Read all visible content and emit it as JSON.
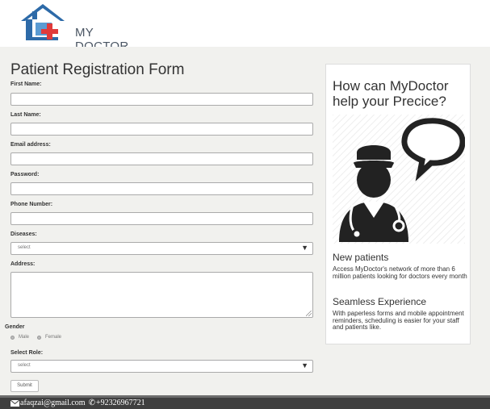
{
  "brand": {
    "name": "MY DOCTOR"
  },
  "form": {
    "title": "Patient Registration Form",
    "fields": {
      "first_name_label": "First Name:",
      "last_name_label": "Last Name:",
      "email_label": "Email address:",
      "password_label": "Password:",
      "phone_label": "Phone Number:",
      "diseases_label": "Diseases:",
      "diseases_value": "select",
      "address_label": "Address:",
      "gender_label": "Gender",
      "gender_male": "Male",
      "gender_female": "Female",
      "role_label": "Select Role:",
      "role_value": "select"
    },
    "submit_label": "Submit"
  },
  "sidebar": {
    "title": "How can MyDoctor help your Precice?",
    "sections": [
      {
        "heading": "New patients",
        "text": "Access MyDoctor's network of more than 6 million patients looking for doctors every month"
      },
      {
        "heading": "Seamless Experience",
        "text": "With paperless forms and mobile appointment reminders, scheduling is easier for your staff and patients like."
      }
    ]
  },
  "footer": {
    "email": "afaqzai@gmail.com",
    "phone": "+92326967721"
  },
  "icons": {
    "logo": "house-cross-logo",
    "illustration": "doctor-speech-bubble-icon",
    "mail": "mail-icon",
    "phone": "phone-icon",
    "select_arrow": "triangle-down-icon"
  },
  "colors": {
    "background": "#f1f1ee",
    "footer": "#3f3f3f",
    "logo_blue": "#2d6aa8",
    "logo_red": "#e03a3a"
  }
}
